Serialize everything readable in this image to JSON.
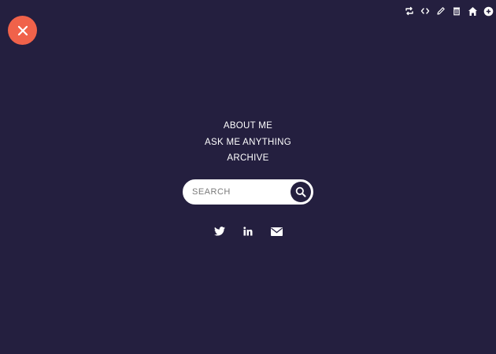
{
  "close": {
    "icon": "close-icon",
    "color": "#f0624a"
  },
  "toolbar": {
    "icons": [
      "reblog-icon",
      "code-icon",
      "edit-icon",
      "delete-icon",
      "home-icon",
      "new-post-icon"
    ]
  },
  "nav": {
    "items": [
      {
        "label": "ABOUT ME"
      },
      {
        "label": "ASK ME ANYTHING"
      },
      {
        "label": "ARCHIVE"
      }
    ]
  },
  "search": {
    "placeholder": "SEARCH",
    "value": "",
    "icon": "search-icon"
  },
  "social": {
    "icons": [
      "twitter-icon",
      "linkedin-icon",
      "email-icon"
    ]
  },
  "colors": {
    "background": "#241f3f",
    "accent": "#f0624a",
    "text": "#ffffff"
  }
}
